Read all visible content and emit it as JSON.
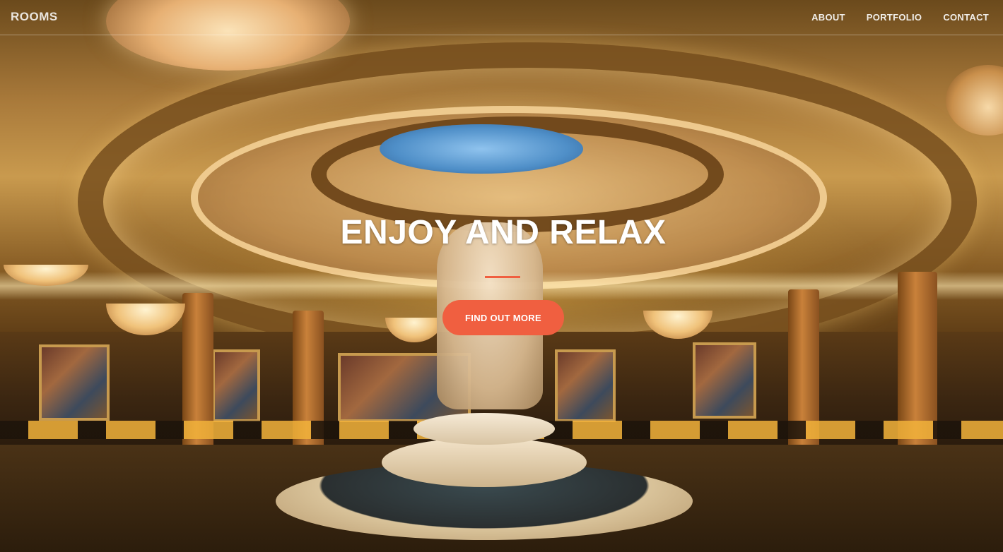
{
  "navbar": {
    "brand": "ROOMS",
    "links": [
      {
        "label": "ABOUT"
      },
      {
        "label": "PORTFOLIO"
      },
      {
        "label": "CONTACT"
      }
    ]
  },
  "hero": {
    "title": "ENJOY AND RELAX",
    "button_label": "FIND OUT MORE",
    "background_image": "hotel lobby rotunda with statue fountain"
  },
  "colors": {
    "accent": "#f05f40",
    "text": "#ffffff"
  }
}
